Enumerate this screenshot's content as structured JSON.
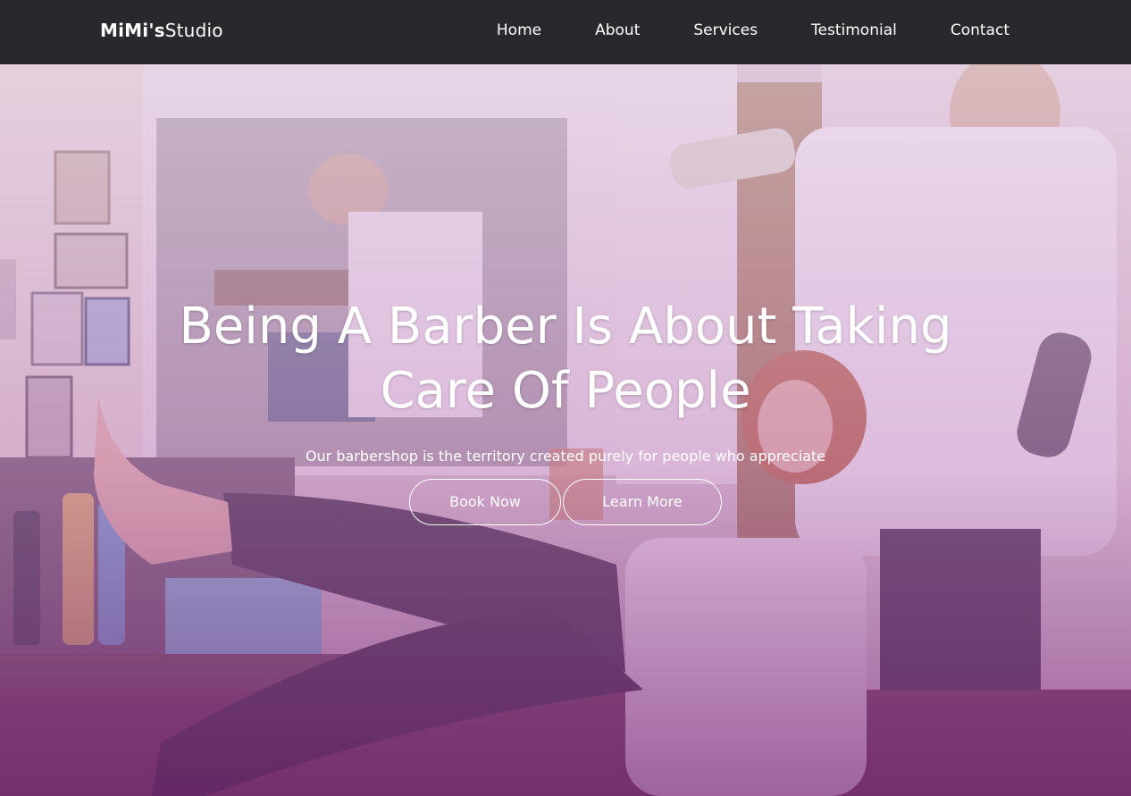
{
  "brand": {
    "bold": "MiMi's",
    "light": "Studio"
  },
  "nav": {
    "items": [
      {
        "label": "Home"
      },
      {
        "label": "About"
      },
      {
        "label": "Services"
      },
      {
        "label": "Testimonial"
      },
      {
        "label": "Contact"
      }
    ]
  },
  "hero": {
    "title_line1": "Being A Barber Is About Taking",
    "title_line2": "Care Of People",
    "subtitle": "Our barbershop is the territory created purely for people who appreciate",
    "book_label": "Book Now",
    "learn_label": "Learn More"
  },
  "colors": {
    "navbar": "#29282d",
    "overlay_top": "#e2c8e4",
    "overlay_bottom": "#782878",
    "text": "#ffffff"
  }
}
